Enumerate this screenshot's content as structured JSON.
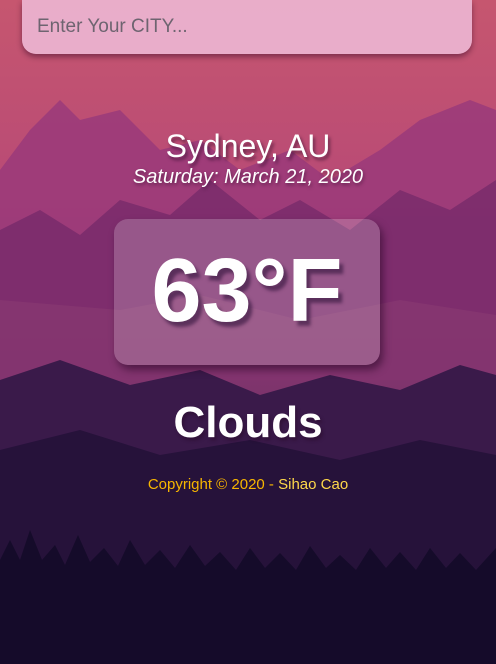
{
  "search": {
    "placeholder": "Enter Your CITY...",
    "value": ""
  },
  "location": {
    "city": "Sydney, AU",
    "date": "Saturday: March 21, 2020"
  },
  "current": {
    "temperature": "63°F",
    "weather": "Clouds"
  },
  "footer": {
    "copyright": "Copyright © 2020 - ",
    "author": "Sihao Cao"
  },
  "colors": {
    "sky_top": "#c6566f",
    "sky_mid": "#a83f78",
    "ground_dark": "#140a28",
    "footer_text": "#f7b500"
  }
}
